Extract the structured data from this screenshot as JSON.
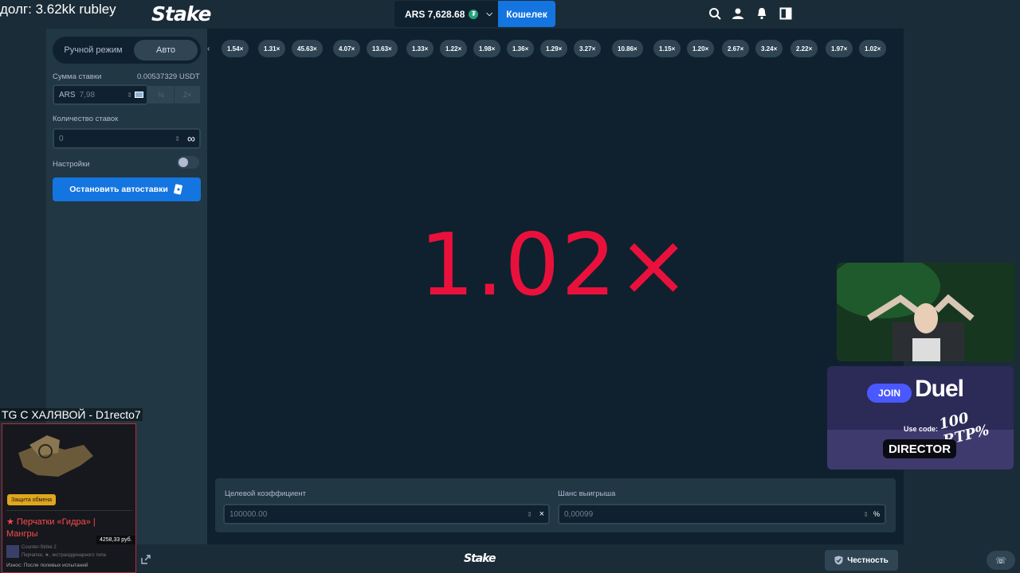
{
  "overlay": {
    "debt_text": "долг: 3.62kk rubley",
    "tg_title": "TG С ХАЛЯВОЙ - D1recto7",
    "skin": {
      "protect_label": "Защита обмена",
      "name": "★ Перчатки «Гидра» | Мангры",
      "price": "4258,33 руб.",
      "game": "Counter-Strike 2",
      "type": "Перчатки, ★, экстраординарного типа",
      "wear": "Износ: После полевых испытаний"
    },
    "promo": {
      "join": "JOIN",
      "brand": "Duel",
      "rtp": "100 RTP%",
      "use_code": "Use code:",
      "code": "DIRECTOR"
    }
  },
  "header": {
    "logo": "Stake",
    "balance": "ARS 7,628.68",
    "wallet_label": "Кошелек",
    "icons": [
      "search-icon",
      "user-icon",
      "bell-icon",
      "sidebar-toggle-icon"
    ]
  },
  "sidebar": {
    "mode_manual": "Ручной режим",
    "mode_auto": "Авто",
    "bet_amount_label": "Сумма ставки",
    "bet_amount_usdt": "0.00537329 USDT",
    "bet_currency": "ARS",
    "bet_value": "7,98",
    "half": "½",
    "double": "2×",
    "bet_count_label": "Количество ставок",
    "bet_count_value": "0",
    "settings_label": "Настройки",
    "stop_autobet": "Остановить автоставки"
  },
  "game": {
    "history": [
      "1.54×",
      "1.31×",
      "45.63×",
      "4.07×",
      "13.63×",
      "1.33×",
      "1.22×",
      "1.98×",
      "1.36×",
      "1.29×",
      "3.27×",
      "10.86×",
      "1.15×",
      "1.20×",
      "2.67×",
      "3.24×",
      "2.22×",
      "1.97×",
      "1.02×"
    ],
    "multiplier": "1.02×",
    "target_label": "Целевой коэффициент",
    "target_value": "100000.00",
    "chance_label": "Шанс выигрыша",
    "chance_value": "0,00099",
    "accent": "#e9113c"
  },
  "footer": {
    "logo": "Stake",
    "fairness": "Честность"
  }
}
